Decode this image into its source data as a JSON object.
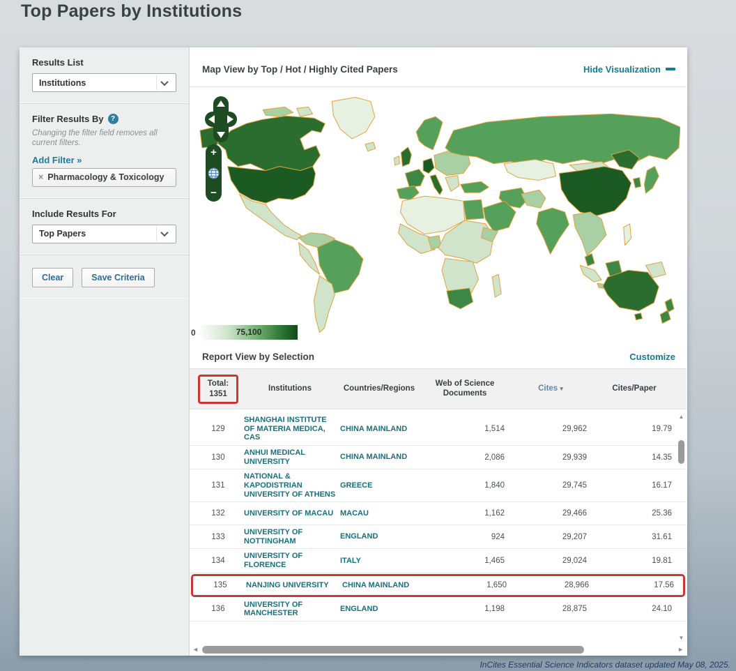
{
  "page": {
    "title": "Top Papers by Institutions",
    "footer": "InCites Essential Science Indicators dataset updated May 08, 2025."
  },
  "icons": {
    "up": "▲",
    "down": "▼",
    "left": "◄",
    "right": "►",
    "sort_down": "▾",
    "plus": "+",
    "minus": "−",
    "help": "?",
    "remove_x": "×"
  },
  "sidebar": {
    "results_list_label": "Results List",
    "results_list_value": "Institutions",
    "filter_label": "Filter Results By",
    "filter_note": "Changing the filter field removes all current filters.",
    "add_filter_link": "Add Filter »",
    "filter_chip": "Pharmacology & Toxicology",
    "include_label": "Include Results For",
    "include_value": "Top Papers",
    "clear_button": "Clear",
    "save_button": "Save Criteria"
  },
  "map": {
    "header": "Map View by Top / Hot / Highly Cited Papers",
    "hide_link": "Hide Visualization",
    "legend_min": "0",
    "legend_max": "75,100"
  },
  "report": {
    "header": "Report View by Selection",
    "customize_link": "Customize",
    "table": {
      "total_label": "Total:",
      "total_value": "1351",
      "columns": {
        "c1": "Institutions",
        "c2": "Countries/Regions",
        "c3": "Web of Science Documents",
        "c4": "Cites",
        "c5": "Cites/Paper"
      },
      "rows": [
        {
          "rank": "129",
          "institution": "SHANGHAI INSTITUTE OF MATERIA MEDICA, CAS",
          "country": "CHINA MAINLAND",
          "docs": "1,514",
          "cites": "29,962",
          "cites_per_paper": "19.79",
          "highlighted": false
        },
        {
          "rank": "130",
          "institution": "ANHUI MEDICAL UNIVERSITY",
          "country": "CHINA MAINLAND",
          "docs": "2,086",
          "cites": "29,939",
          "cites_per_paper": "14.35",
          "highlighted": false
        },
        {
          "rank": "131",
          "institution": "NATIONAL & KAPODISTRIAN UNIVERSITY OF ATHENS",
          "country": "GREECE",
          "docs": "1,840",
          "cites": "29,745",
          "cites_per_paper": "16.17",
          "highlighted": false
        },
        {
          "rank": "132",
          "institution": "UNIVERSITY OF MACAU",
          "country": "MACAU",
          "docs": "1,162",
          "cites": "29,466",
          "cites_per_paper": "25.36",
          "highlighted": false
        },
        {
          "rank": "133",
          "institution": "UNIVERSITY OF NOTTINGHAM",
          "country": "ENGLAND",
          "docs": "924",
          "cites": "29,207",
          "cites_per_paper": "31.61",
          "highlighted": false
        },
        {
          "rank": "134",
          "institution": "UNIVERSITY OF FLORENCE",
          "country": "ITALY",
          "docs": "1,465",
          "cites": "29,024",
          "cites_per_paper": "19.81",
          "highlighted": false
        },
        {
          "rank": "135",
          "institution": "NANJING UNIVERSITY",
          "country": "CHINA MAINLAND",
          "docs": "1,650",
          "cites": "28,966",
          "cites_per_paper": "17.56",
          "highlighted": true
        },
        {
          "rank": "136",
          "institution": "UNIVERSITY OF MANCHESTER",
          "country": "ENGLAND",
          "docs": "1,198",
          "cites": "28,875",
          "cites_per_paper": "24.10",
          "highlighted": false
        }
      ]
    }
  },
  "colors": {
    "accent_teal": "#0c7f92",
    "link_blue": "#1d7aa3",
    "annotation_red": "#c9392f",
    "choropleth_low": "#e6f1e2",
    "choropleth_high": "#1c5a24",
    "map_border": "#e0a23c"
  }
}
